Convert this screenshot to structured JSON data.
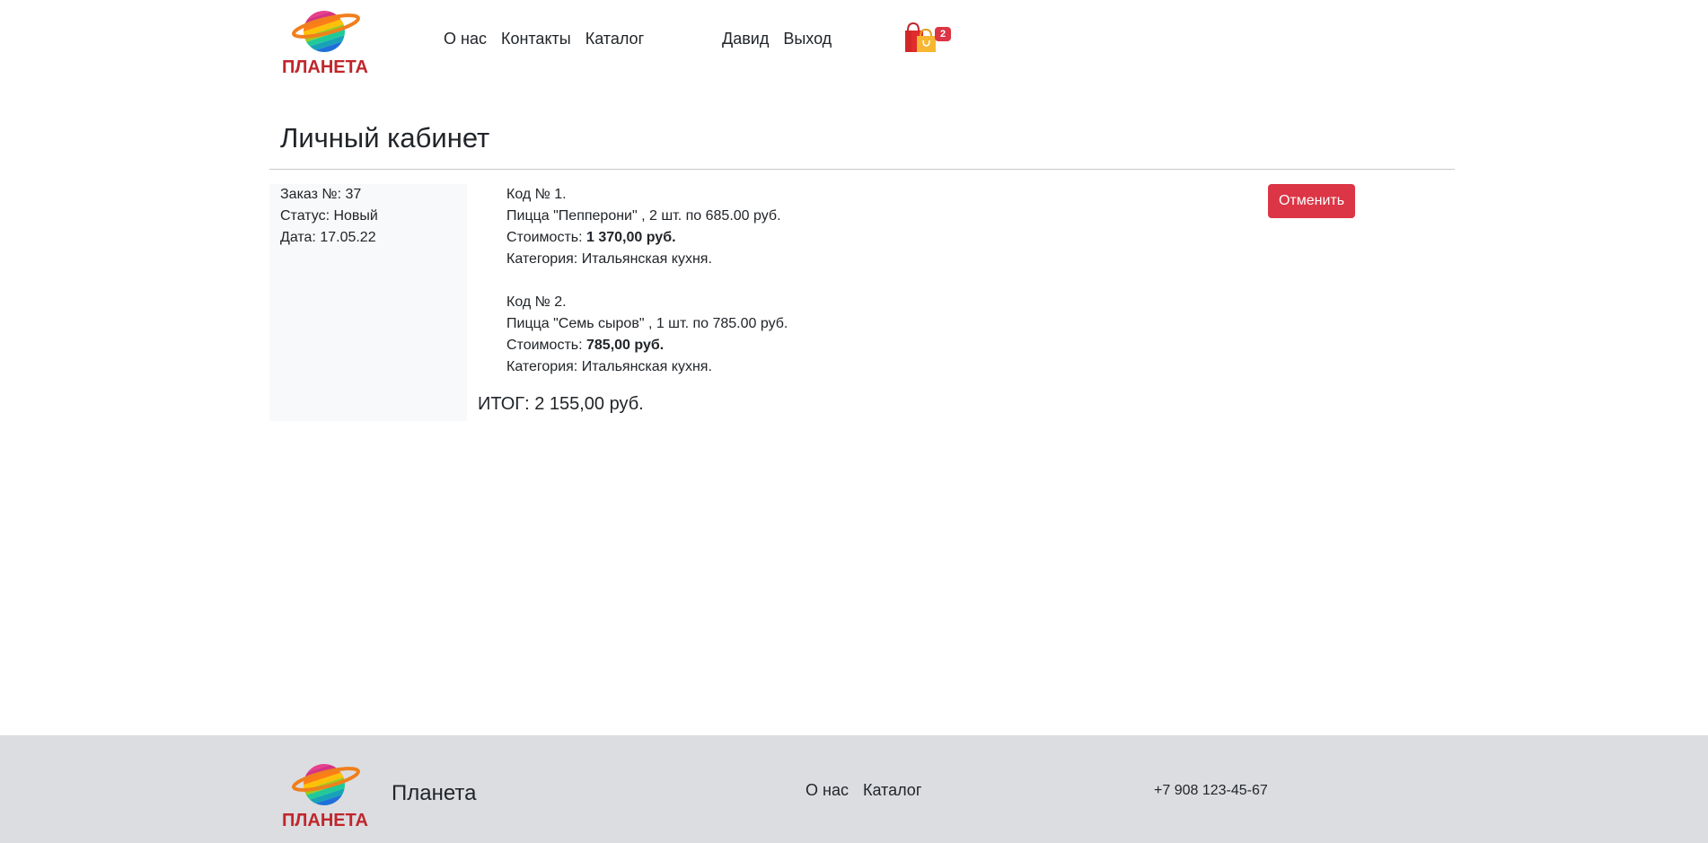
{
  "brand": {
    "logo_text": "ПЛАНЕТА",
    "name": "Планета",
    "colors": {
      "logo_red": "#c0262b",
      "accent_orange": "#f07f1d"
    }
  },
  "header": {
    "nav": [
      {
        "label": "О нас"
      },
      {
        "label": "Контакты"
      },
      {
        "label": "Каталог"
      }
    ],
    "user_nav": [
      {
        "label": "Давид"
      },
      {
        "label": "Выход"
      }
    ],
    "cart": {
      "icon": "shopping-bags-icon",
      "count": "2"
    }
  },
  "main": {
    "title": "Личный кабинет",
    "order": {
      "number_label": "Заказ №: 37",
      "status_label": "Статус: Новый",
      "date_label": "Дата: 17.05.22",
      "items": [
        {
          "code": "Код № 1.",
          "description": "Пицца \"Пепперони\" , 2 шт. по 685.00 руб.",
          "cost_label": "Стоимость: ",
          "cost_value": "1 370,00 руб.",
          "category": "Категория: Итальянская кухня."
        },
        {
          "code": "Код № 2.",
          "description": "Пицца \"Семь сыров\" , 1 шт. по 785.00 руб.",
          "cost_label": "Стоимость: ",
          "cost_value": "785,00 руб.",
          "category": "Категория: Итальянская кухня."
        }
      ],
      "total": "ИТОГ: 2 155,00 руб.",
      "cancel_label": "Отменить"
    }
  },
  "footer": {
    "name": "Планета",
    "nav": [
      {
        "label": "О нас"
      },
      {
        "label": "Каталог"
      }
    ],
    "phone": "+7 908 123-45-67"
  }
}
